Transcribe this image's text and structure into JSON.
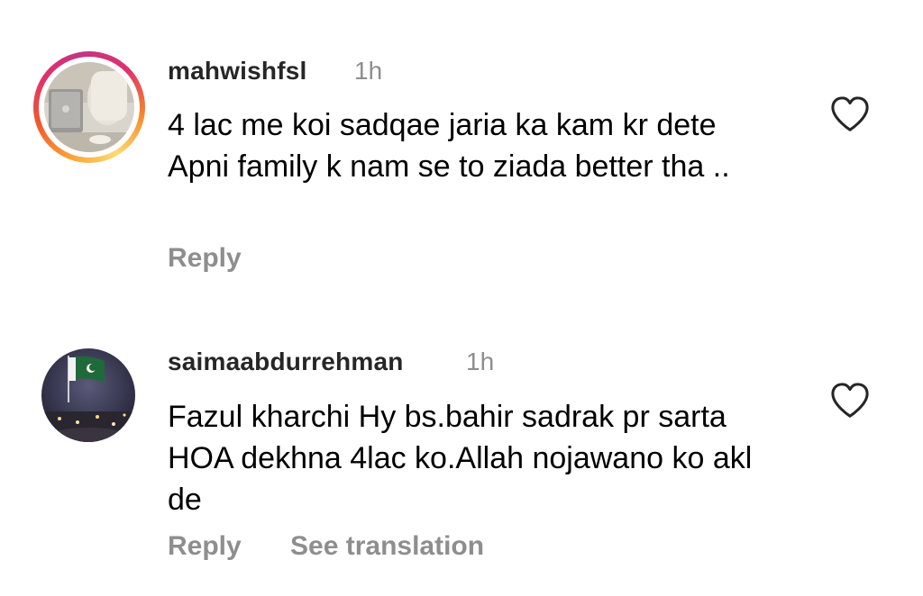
{
  "comments": [
    {
      "username": "mahwishfsl",
      "time": "1h",
      "text": "4 lac me koi sadqae jaria ka kam kr dete Apni family k nam se to ziada better tha ..",
      "reply_label": "Reply",
      "has_story_ring": true
    },
    {
      "username": "saimaabdurrehman",
      "time": "1h",
      "text": "Fazul kharchi Hy bs.bahir sadrak pr sarta HOA dekhna 4lac ko.Allah nojawano ko akl de",
      "reply_label": "Reply",
      "translate_label": "See translation",
      "has_story_ring": false
    }
  ],
  "icons": {
    "like": "heart-outline-icon"
  },
  "colors": {
    "secondary_text": "#8e8e8e",
    "username": "#262626",
    "ring_gradient": [
      "#feda75",
      "#f58529",
      "#e1306c",
      "#c13584"
    ]
  }
}
